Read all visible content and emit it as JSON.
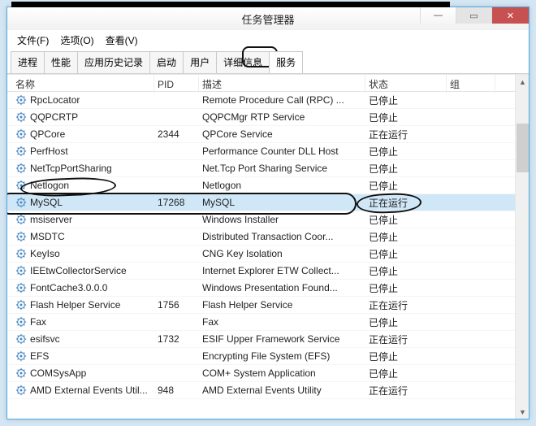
{
  "window": {
    "title": "任务管理器",
    "min_glyph": "—",
    "max_glyph": "▭",
    "close_glyph": "✕"
  },
  "menu": {
    "file": "文件(F)",
    "options": "选项(O)",
    "view": "查看(V)"
  },
  "tabs": {
    "processes": "进程",
    "performance": "性能",
    "app_history": "应用历史记录",
    "startup": "启动",
    "users": "用户",
    "details": "详细信息",
    "services": "服务"
  },
  "columns": {
    "name": "名称",
    "pid": "PID",
    "desc": "描述",
    "status": "状态",
    "group": "组"
  },
  "status_labels": {
    "stopped": "已停止",
    "running": "正在运行"
  },
  "services": [
    {
      "name": "RpcLocator",
      "pid": "",
      "desc": "Remote Procedure Call (RPC) ...",
      "status": "已停止",
      "selected": false
    },
    {
      "name": "QQPCRTP",
      "pid": "",
      "desc": "QQPCMgr RTP Service",
      "status": "已停止",
      "selected": false
    },
    {
      "name": "QPCore",
      "pid": "2344",
      "desc": "QPCore Service",
      "status": "正在运行",
      "selected": false
    },
    {
      "name": "PerfHost",
      "pid": "",
      "desc": "Performance Counter DLL Host",
      "status": "已停止",
      "selected": false
    },
    {
      "name": "NetTcpPortSharing",
      "pid": "",
      "desc": "Net.Tcp Port Sharing Service",
      "status": "已停止",
      "selected": false
    },
    {
      "name": "Netlogon",
      "pid": "",
      "desc": "Netlogon",
      "status": "已停止",
      "selected": false
    },
    {
      "name": "MySQL",
      "pid": "17268",
      "desc": "MySQL",
      "status": "正在运行",
      "selected": true
    },
    {
      "name": "msiserver",
      "pid": "",
      "desc": "Windows Installer",
      "status": "已停止",
      "selected": false
    },
    {
      "name": "MSDTC",
      "pid": "",
      "desc": "Distributed Transaction Coor...",
      "status": "已停止",
      "selected": false
    },
    {
      "name": "KeyIso",
      "pid": "",
      "desc": "CNG Key Isolation",
      "status": "已停止",
      "selected": false
    },
    {
      "name": "IEEtwCollectorService",
      "pid": "",
      "desc": "Internet Explorer ETW Collect...",
      "status": "已停止",
      "selected": false
    },
    {
      "name": "FontCache3.0.0.0",
      "pid": "",
      "desc": "Windows Presentation Found...",
      "status": "已停止",
      "selected": false
    },
    {
      "name": "Flash Helper Service",
      "pid": "1756",
      "desc": "Flash Helper Service",
      "status": "正在运行",
      "selected": false
    },
    {
      "name": "Fax",
      "pid": "",
      "desc": "Fax",
      "status": "已停止",
      "selected": false
    },
    {
      "name": "esifsvc",
      "pid": "1732",
      "desc": "ESIF Upper Framework Service",
      "status": "正在运行",
      "selected": false
    },
    {
      "name": "EFS",
      "pid": "",
      "desc": "Encrypting File System (EFS)",
      "status": "已停止",
      "selected": false
    },
    {
      "name": "COMSysApp",
      "pid": "",
      "desc": "COM+ System Application",
      "status": "已停止",
      "selected": false
    },
    {
      "name": "AMD External Events Util...",
      "pid": "948",
      "desc": "AMD External Events Utility",
      "status": "正在运行",
      "selected": false
    }
  ],
  "annotations": {
    "tab_circled": "services",
    "row_circled": "MySQL",
    "small_blobs": [
      "Netlogon",
      "MySQL_status"
    ]
  }
}
